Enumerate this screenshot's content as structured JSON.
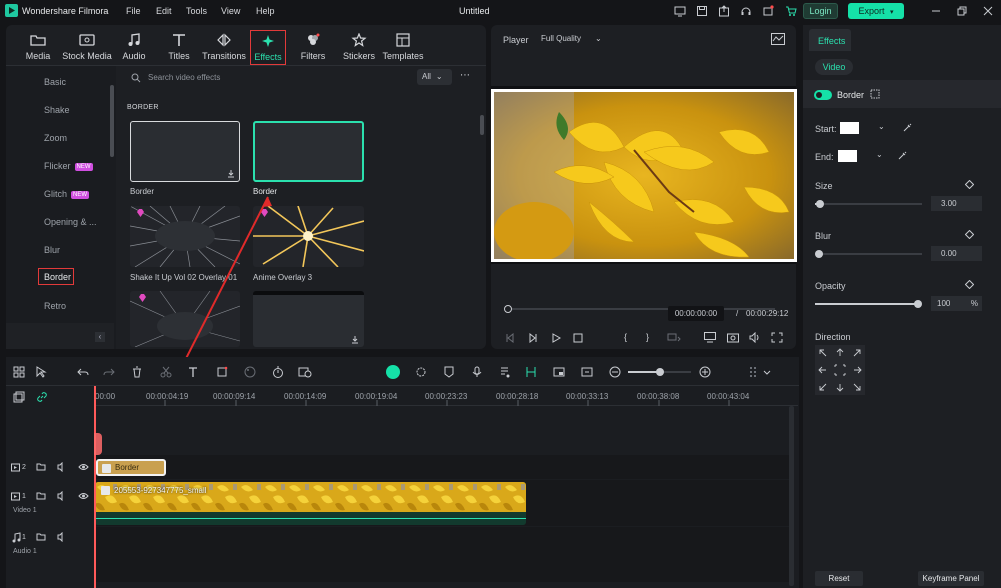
{
  "app": {
    "name": "Wondershare Filmora",
    "project_title": "Untitled",
    "menu": [
      "File",
      "Edit",
      "Tools",
      "View",
      "Help"
    ],
    "login_label": "Login",
    "export_label": "Export"
  },
  "media_tabs": [
    {
      "label": "Media",
      "icon": "folder-icon"
    },
    {
      "label": "Stock Media",
      "icon": "stock-media-icon"
    },
    {
      "label": "Audio",
      "icon": "music-note-icon"
    },
    {
      "label": "Titles",
      "icon": "titles-t-icon"
    },
    {
      "label": "Transitions",
      "icon": "transitions-icon"
    },
    {
      "label": "Effects",
      "icon": "effects-sparkle-icon",
      "active": true
    },
    {
      "label": "Filters",
      "icon": "filters-icon"
    },
    {
      "label": "Stickers",
      "icon": "stickers-icon"
    },
    {
      "label": "Templates",
      "icon": "templates-icon"
    }
  ],
  "effects_sidebar": [
    {
      "label": "Basic"
    },
    {
      "label": "Shake"
    },
    {
      "label": "Zoom"
    },
    {
      "label": "Flicker",
      "badge": "NEW"
    },
    {
      "label": "Glitch",
      "badge": "NEW"
    },
    {
      "label": "Opening & ..."
    },
    {
      "label": "Blur"
    },
    {
      "label": "Border",
      "selected": true
    },
    {
      "label": "Retro"
    }
  ],
  "search": {
    "placeholder": "Search video effects",
    "filter_label": "All"
  },
  "section_title": "BORDER",
  "effect_cards": [
    {
      "label": "Border"
    },
    {
      "label": "Border"
    },
    {
      "label": "Shake It Up Vol 02 Overlay 01"
    },
    {
      "label": "Anime Overlay 3"
    },
    {
      "label": ""
    },
    {
      "label": ""
    }
  ],
  "player": {
    "label": "Player",
    "quality": "Full Quality",
    "current_time": "00:00:00:00",
    "separator": "/",
    "total_time": "00:00:29:12"
  },
  "properties": {
    "tab_effects": "Effects",
    "tab_video": "Video",
    "effect_name": "Border",
    "start_label": "Start:",
    "end_label": "End:",
    "size_label": "Size",
    "size_value": "3.00",
    "size_fraction": 0.05,
    "blur_label": "Blur",
    "blur_value": "0.00",
    "blur_fraction": 0.0,
    "opacity_label": "Opacity",
    "opacity_value": "100",
    "opacity_unit": "%",
    "opacity_fraction": 1.0,
    "direction_label": "Direction",
    "reset_label": "Reset",
    "keyframe_label": "Keyframe Panel",
    "start_color": "#ffffff",
    "end_color": "#ffffff"
  },
  "timeline": {
    "ruler": [
      "00:00",
      "00:00:04:19",
      "00:00:09:14",
      "00:00:14:09",
      "00:00:19:04",
      "00:00:23:23",
      "00:00:28:18",
      "00:00:33:13",
      "00:00:38:08",
      "00:00:43:04"
    ],
    "tracks": [
      {
        "index": "2",
        "name": ""
      },
      {
        "index": "1",
        "name": "Video 1"
      },
      {
        "index": "1",
        "name": "Audio 1"
      }
    ],
    "effect_clip_label": "Border",
    "video_clip_label": "205553-927347775_small"
  },
  "colors": {
    "accent": "#15e1a8",
    "highlight_box": "#e23a3a",
    "arrow": "#e02a2a",
    "effect_clip": "#c9a04f",
    "playhead": "#ff5a5a",
    "new_badge": "#d04fe0"
  }
}
